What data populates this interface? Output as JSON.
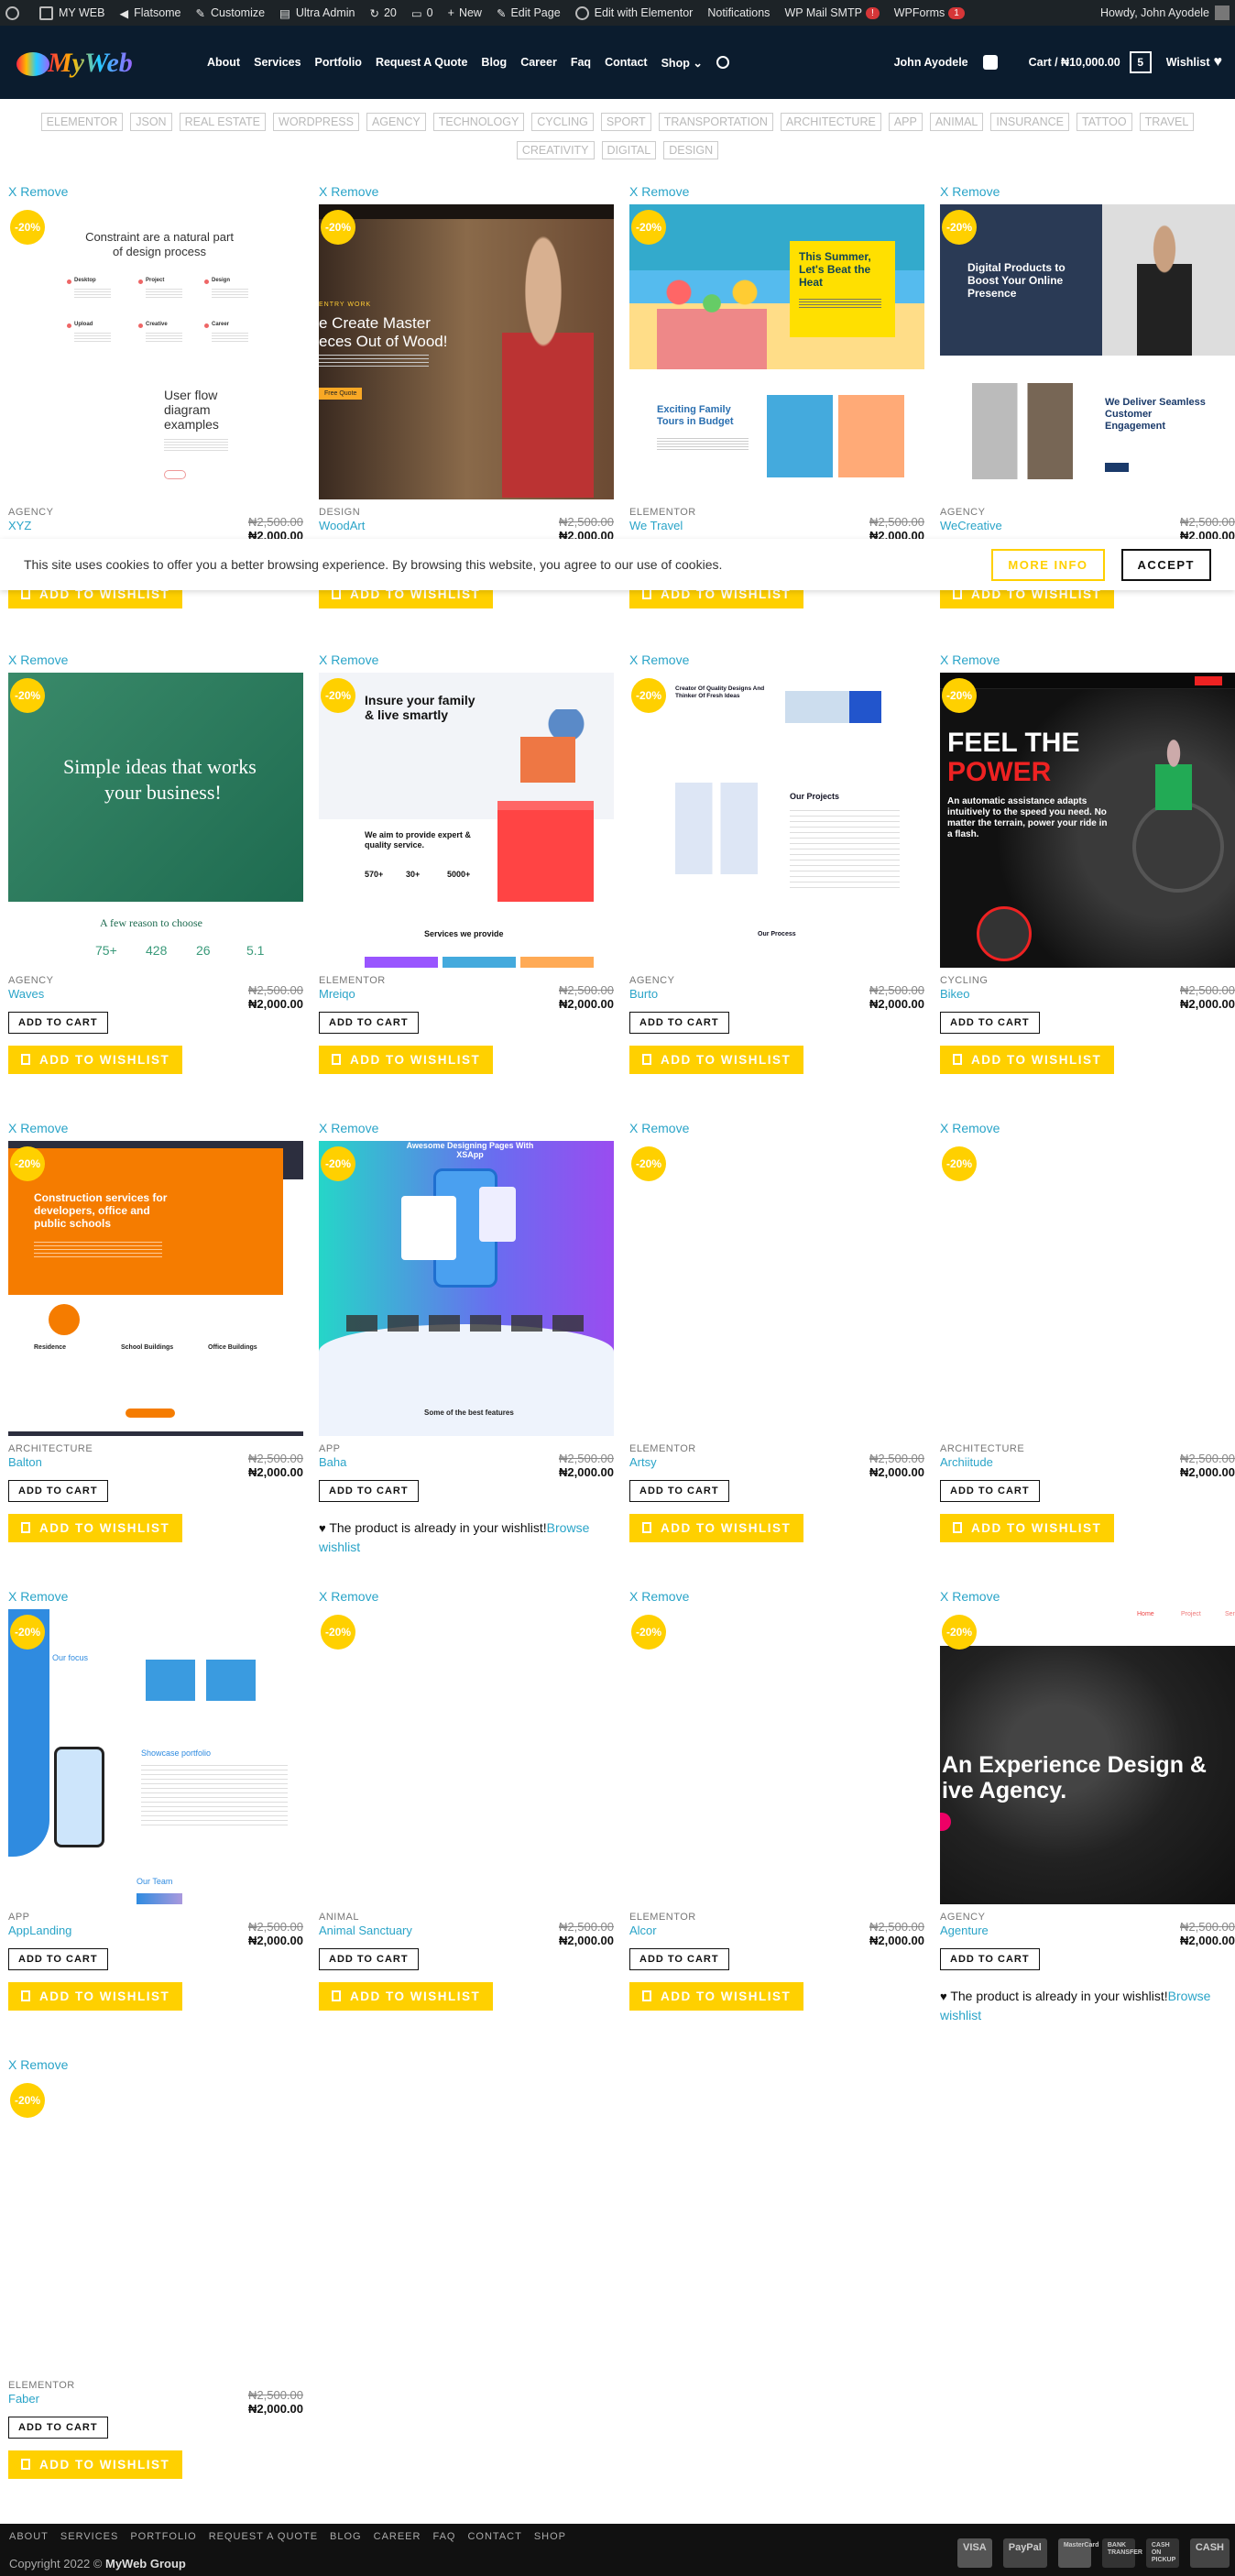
{
  "adminbar": {
    "site": "MY WEB",
    "theme": "Flatsome",
    "customize": "Customize",
    "ultra": "Ultra Admin",
    "updates": "20",
    "comments": "0",
    "new": "New",
    "edit_page": "Edit Page",
    "elementor": "Edit with Elementor",
    "notifications": "Notifications",
    "smtp": "WP Mail SMTP",
    "smtp_badge": "!",
    "wpforms": "WPForms",
    "wpforms_badge": "1",
    "howdy": "Howdy, John Ayodele"
  },
  "header": {
    "logo_text": "MyWeb",
    "nav": [
      "About",
      "Services",
      "Portfolio",
      "Request A Quote",
      "Blog",
      "Career",
      "Faq",
      "Contact",
      "Shop"
    ],
    "user": "John Ayodele",
    "cart": "Cart / ₦10,000.00",
    "cart_count": "5",
    "wishlist": "Wishlist"
  },
  "tags": [
    "Elementor",
    "JSON",
    "Real Estate",
    "WordPress",
    "Agency",
    "Technology",
    "Cycling",
    "Sport",
    "Transportation",
    "Architecture",
    "App",
    "Animal",
    "Insurance",
    "Tattoo",
    "Travel",
    "Creativity",
    "Digital",
    "Design"
  ],
  "cookie": {
    "text": "This site uses cookies to offer you a better browsing experience. By browsing this website, you agree to our use of cookies.",
    "more": "MORE INFO",
    "accept": "ACCEPT"
  },
  "labels": {
    "remove": "X Remove",
    "sale": "-20%",
    "add_to_cart": "ADD TO CART",
    "add_to_wishlist": "ADD TO WISHLIST",
    "already": "The product is already in your wishlist!",
    "browse": "Browse wishlist"
  },
  "products": [
    {
      "cat": "Agency",
      "name": "XYZ",
      "old": "₦2,500.00",
      "new": "₦2,000.00",
      "state": "cookie",
      "thumb": "xyz",
      "thumb_text": [
        "Constraint are a natural part of design process",
        "Desktop",
        "Project",
        "Design",
        "Upload",
        "Creative",
        "Career",
        "User flow diagram examples"
      ]
    },
    {
      "cat": "Design",
      "name": "WoodArt",
      "old": "₦2,500.00",
      "new": "₦2,000.00",
      "state": "cookie",
      "thumb": "woodart",
      "thumb_text": [
        "ENTRY WORK",
        "e Create Master",
        "eces Out of Wood!",
        "Free Quote"
      ]
    },
    {
      "cat": "Elementor",
      "name": "We Travel",
      "old": "₦2,500.00",
      "new": "₦2,000.00",
      "state": "cookie",
      "thumb": "travel",
      "thumb_text": [
        "This Summer, Let's Beat the Heat",
        "Exciting Family Tours in Budget"
      ]
    },
    {
      "cat": "Agency",
      "name": "WeCreative",
      "old": "₦2,500.00",
      "new": "₦2,000.00",
      "state": "cookie",
      "thumb": "wecreative",
      "thumb_text": [
        "Digital Products to Boost Your Online Presence",
        "We Deliver Seamless Customer Engagement"
      ]
    },
    {
      "cat": "Agency",
      "name": "Waves",
      "old": "₦2,500.00",
      "new": "₦2,000.00",
      "state": "cart",
      "thumb": "waves",
      "thumb_text": [
        "Simple ideas that works",
        "your business!",
        "A few reason to choose",
        "75+",
        "428",
        "26",
        "5.1"
      ]
    },
    {
      "cat": "Elementor",
      "name": "Mreiqo",
      "old": "₦2,500.00",
      "new": "₦2,000.00",
      "state": "cart",
      "thumb": "mreiqo",
      "thumb_text": [
        "Insure your family & live smartly",
        "We aim to provide expert & quality service.",
        "Services we provide",
        "570+",
        "30+",
        "5000+"
      ]
    },
    {
      "cat": "Agency",
      "name": "Burto",
      "old": "₦2,500.00",
      "new": "₦2,000.00",
      "state": "cart",
      "thumb": "burto",
      "thumb_text": [
        "Creator Of Quality Designs And Thinker Of Fresh Ideas",
        "Our Projects",
        "Our Process"
      ]
    },
    {
      "cat": "Cycling",
      "name": "Bikeo",
      "old": "₦2,500.00",
      "new": "₦2,000.00",
      "state": "cart",
      "thumb": "bikeo",
      "thumb_text": [
        "FEEL THE",
        "POWER",
        "An automatic assistance adapts intuitively to the speed you need. No matter the terrain, power your ride in a flash."
      ]
    },
    {
      "cat": "Architecture",
      "name": "Balton",
      "old": "₦2,500.00",
      "new": "₦2,000.00",
      "state": "cart",
      "thumb": "balton",
      "thumb_text": [
        "Construction services for developers, office and public schools",
        "Residence",
        "School Buildings",
        "Office Buildings"
      ]
    },
    {
      "cat": "App",
      "name": "Baha",
      "old": "₦2,500.00",
      "new": "₦2,000.00",
      "state": "already",
      "thumb": "baha",
      "thumb_text": [
        "Awesome Designing Pages With XSApp",
        "Some of the best features"
      ]
    },
    {
      "cat": "Elementor",
      "name": "Artsy",
      "old": "₦2,500.00",
      "new": "₦2,000.00",
      "state": "cart",
      "thumb": "blank",
      "thumb_text": []
    },
    {
      "cat": "Architecture",
      "name": "Archiitude",
      "old": "₦2,500.00",
      "new": "₦2,000.00",
      "state": "cart",
      "thumb": "blank",
      "thumb_text": []
    },
    {
      "cat": "App",
      "name": "AppLanding",
      "old": "₦2,500.00",
      "new": "₦2,000.00",
      "state": "cart",
      "thumb": "applanding",
      "thumb_text": [
        "Our focus",
        "Showcase portfolio",
        "Our Team"
      ]
    },
    {
      "cat": "Animal",
      "name": "Animal Sanctuary",
      "old": "₦2,500.00",
      "new": "₦2,000.00",
      "state": "cart",
      "thumb": "blank",
      "thumb_text": []
    },
    {
      "cat": "Elementor",
      "name": "Alcor",
      "old": "₦2,500.00",
      "new": "₦2,000.00",
      "state": "cart",
      "thumb": "blank",
      "thumb_text": []
    },
    {
      "cat": "Agency",
      "name": "Agenture",
      "old": "₦2,500.00",
      "new": "₦2,000.00",
      "state": "already",
      "thumb": "agenture",
      "thumb_text": [
        "Home",
        "Project",
        "Service",
        "An Experience Design &",
        "ive Agency."
      ]
    },
    {
      "cat": "Elementor",
      "name": "Faber",
      "old": "₦2,500.00",
      "new": "₦2,000.00",
      "state": "cart",
      "thumb": "blank",
      "thumb_text": []
    }
  ],
  "footer": {
    "nav": [
      "ABOUT",
      "SERVICES",
      "PORTFOLIO",
      "REQUEST A QUOTE",
      "BLOG",
      "CAREER",
      "FAQ",
      "CONTACT",
      "SHOP"
    ],
    "copyright_prefix": "Copyright 2022 ©",
    "copyright_brand": "MyWeb Group",
    "payments": [
      "VISA",
      "PayPal",
      "MasterCard",
      "BANK TRANSFER",
      "CASH ON PICKUP",
      "CASH"
    ]
  },
  "colors": {
    "accent": "#ffd000",
    "link": "#2aa4c8",
    "header_bg": "#0b1c2e",
    "adminbar_bg": "#1d2327",
    "footer_bg": "#111111"
  }
}
